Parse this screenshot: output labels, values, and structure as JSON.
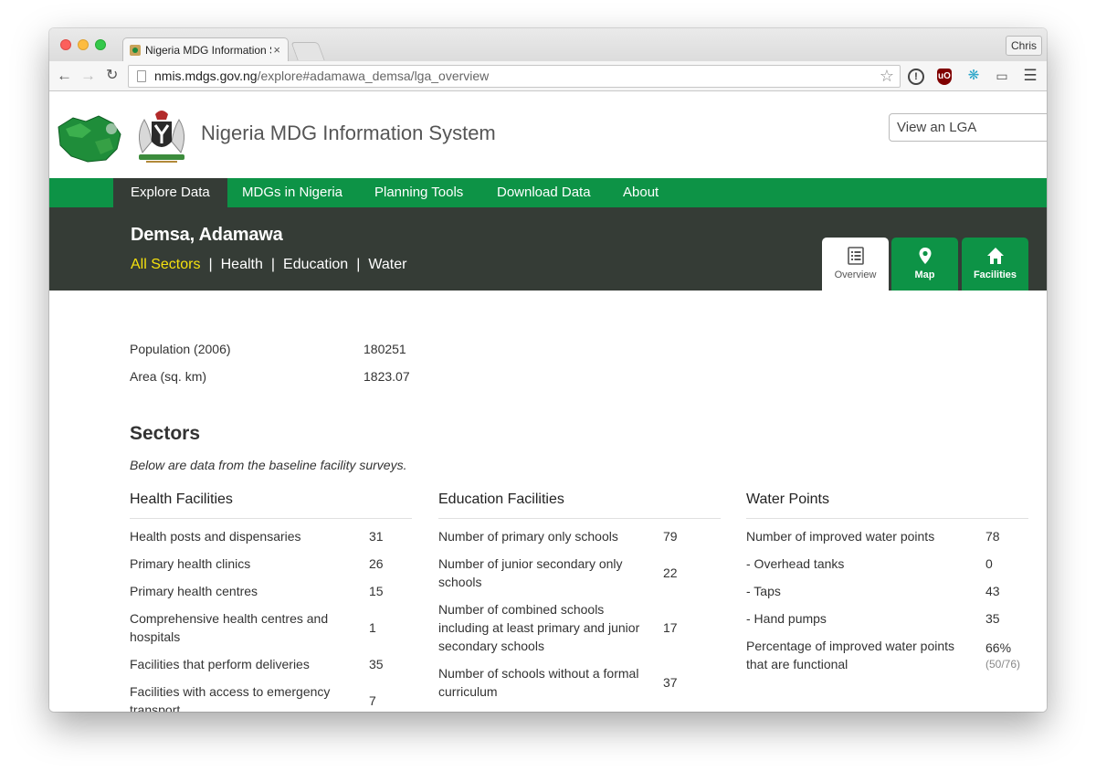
{
  "browser": {
    "tab_title": "Nigeria MDG Information S",
    "tab_close": "×",
    "user": "Chris",
    "url_host": "nmis.mdgs.gov.ng",
    "url_path": "/explore#adamawa_demsa/lga_overview",
    "icons": [
      "back-arrow-icon",
      "forward-arrow-icon",
      "reload-icon",
      "page-icon",
      "star-icon",
      "info-icon",
      "ublock-icon",
      "molecule-icon",
      "cast-icon",
      "menu-icon"
    ]
  },
  "header": {
    "site_title": "Nigeria MDG Information System",
    "lga_select_value": "View an LGA"
  },
  "nav": {
    "items": [
      "Explore Data",
      "MDGs in Nigeria",
      "Planning Tools",
      "Download Data",
      "About"
    ],
    "active": "Explore Data"
  },
  "lga": {
    "name": "Demsa, Adamawa",
    "sectors": [
      "All Sectors",
      "Health",
      "Education",
      "Water"
    ],
    "separator": "|",
    "active_sector": "All Sectors"
  },
  "views": {
    "overview": "Overview",
    "map": "Map",
    "facilities": "Facilities",
    "active": "Overview"
  },
  "stats": [
    {
      "label": "Population (2006)",
      "value": "180251"
    },
    {
      "label": "Area (sq. km)",
      "value": "1823.07"
    }
  ],
  "sectors_title": "Sectors",
  "sectors_note": "Below are data from the baseline facility surveys.",
  "health": {
    "title": "Health Facilities",
    "rows": [
      {
        "label": "Health posts and dispensaries",
        "value": "31"
      },
      {
        "label": "Primary health clinics",
        "value": "26"
      },
      {
        "label": "Primary health centres",
        "value": "15"
      },
      {
        "label": "Comprehensive health centres and hospitals",
        "value": "1"
      },
      {
        "label": "Facilities that perform deliveries",
        "value": "35"
      },
      {
        "label": "Facilities with access to emergency transport",
        "value": "7"
      }
    ]
  },
  "education": {
    "title": "Education Facilities",
    "rows": [
      {
        "label": "Number of primary only schools",
        "value": "79"
      },
      {
        "label": "Number of junior secondary only schools",
        "value": "22"
      },
      {
        "label": "Number of combined schools including at least primary and junior secondary schools",
        "value": "17"
      },
      {
        "label": "Number of schools without a formal curriculum",
        "value": "37"
      }
    ]
  },
  "water": {
    "title": "Water Points",
    "rows": [
      {
        "label": "Number of improved water points",
        "value": "78",
        "sub": ""
      },
      {
        "label": "- Overhead tanks",
        "value": "0",
        "sub": ""
      },
      {
        "label": "- Taps",
        "value": "43",
        "sub": ""
      },
      {
        "label": "- Hand pumps",
        "value": "35",
        "sub": ""
      },
      {
        "label": "Percentage of improved water points that are functional",
        "value": "66%",
        "sub": "(50/76)"
      }
    ]
  },
  "colors": {
    "brand_green": "#0d9346",
    "dark_band": "#353c36",
    "active_sector": "#f5e10e"
  }
}
